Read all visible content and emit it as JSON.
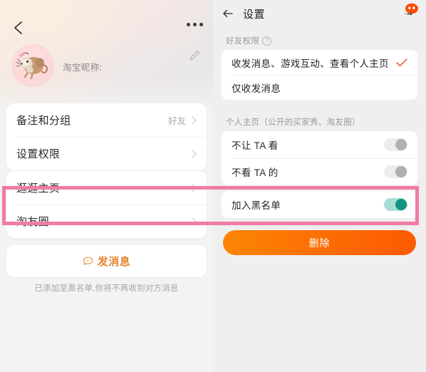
{
  "left_panel": {
    "back_icon": "chevron-left-icon",
    "more_icon": "more-dots-icon",
    "edit_icon": "pencil-edit-icon",
    "avatar_icon": "mouse-cartoon-avatar",
    "nickname_label": "淘宝昵称:",
    "cards": [
      {
        "rows": [
          {
            "label": "备注和分组",
            "value": "好友",
            "chevron": true
          },
          {
            "label": "设置权限",
            "value": "",
            "chevron": true
          }
        ]
      },
      {
        "rows": [
          {
            "label": "逛逛主页",
            "value": "",
            "chevron": true
          },
          {
            "label": "淘友圈",
            "value": "",
            "chevron": true
          }
        ]
      }
    ],
    "message_button": {
      "label": "发消息",
      "icon": "speech-bubble-icon",
      "color": "#e1852f"
    },
    "note": "已添加至黑名单,你将不再收到对方消息"
  },
  "right_panel": {
    "back_icon": "arrow-left-icon",
    "title": "设置",
    "chat_icon": "orange-chat-bubble-icon",
    "sections": [
      {
        "heading": "好友权限",
        "help_icon": "question-mark-icon",
        "help_glyph": "?",
        "options": [
          {
            "label": "收发消息、游戏互动、查看个人主页",
            "selected": true,
            "check_icon": "checkmark-icon"
          },
          {
            "label": "仅收发消息",
            "selected": false
          }
        ]
      },
      {
        "heading": "个人主页（公开的买家秀、淘友圈）",
        "toggles": [
          {
            "label": "不让 TA 看",
            "state": "off"
          },
          {
            "label": "不看 TA 的",
            "state": "off"
          }
        ]
      }
    ],
    "blacklist_row": {
      "label": "加入黑名单",
      "state": "on"
    },
    "delete_button": {
      "label": "删除"
    },
    "highlight": {
      "color": "#f07ca6"
    }
  }
}
